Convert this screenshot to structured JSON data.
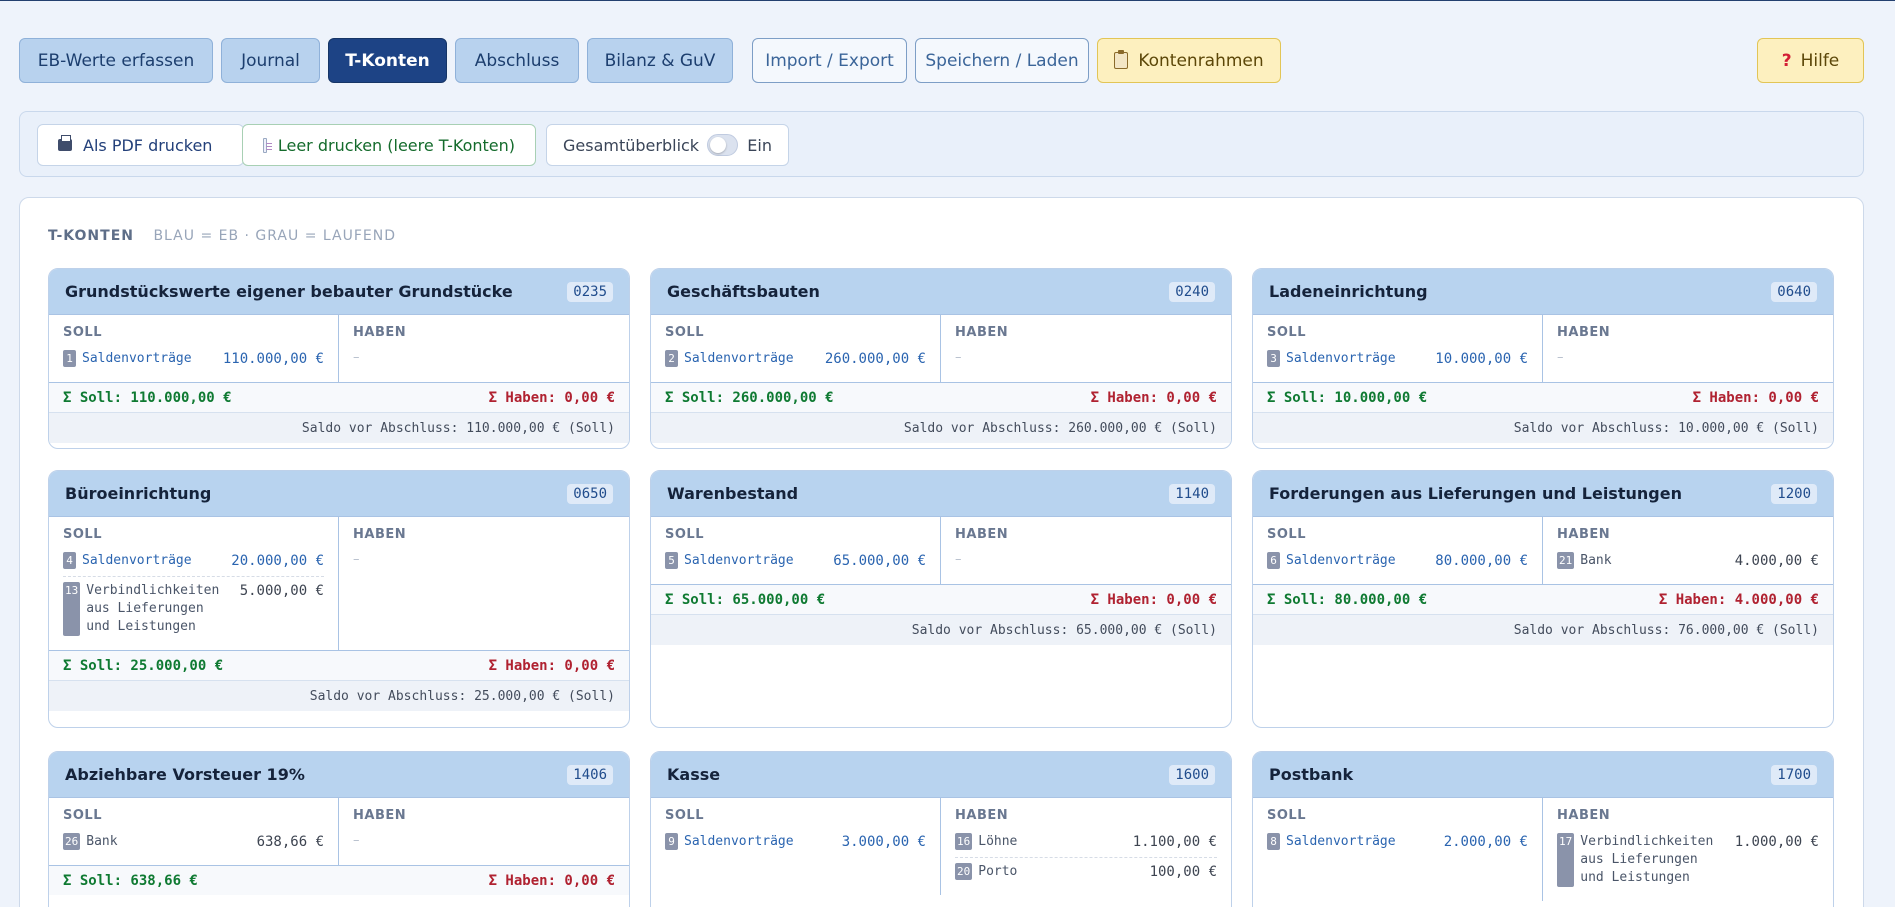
{
  "nav": {
    "eb": "EB-Werte erfassen",
    "journal": "Journal",
    "tkonten": "T-Konten",
    "abschluss": "Abschluss",
    "bilanz": "Bilanz & GuV",
    "import": "Import / Export",
    "speichern": "Speichern / Laden",
    "kontenrahmen": "Kontenrahmen",
    "hilfe": "Hilfe"
  },
  "toolbar": {
    "pdf": "Als PDF drucken",
    "leer": "Leer drucken (leere T-Konten)",
    "overview_label": "Gesamtüberblick",
    "overview_state": "Ein"
  },
  "section": {
    "title": "T-KONTEN",
    "subtitle": "BLAU = EB · GRAU = LAUFEND"
  },
  "labels": {
    "soll": "SOLL",
    "haben": "HABEN",
    "dash": "–"
  },
  "accounts": [
    {
      "title": "Grundstückswerte eigener bebauter Grundstücke",
      "number": "0235",
      "soll": [
        {
          "id": "1",
          "name": "Saldenvorträge",
          "amount": "110.000,00 €"
        }
      ],
      "haben": [],
      "sum_soll": "Σ Soll: 110.000,00 €",
      "sum_haben": "Σ Haben: 0,00 €",
      "saldo": "Saldo vor Abschluss: 110.000,00 € (Soll)"
    },
    {
      "title": "Geschäftsbauten",
      "number": "0240",
      "soll": [
        {
          "id": "2",
          "name": "Saldenvorträge",
          "amount": "260.000,00 €"
        }
      ],
      "haben": [],
      "sum_soll": "Σ Soll: 260.000,00 €",
      "sum_haben": "Σ Haben: 0,00 €",
      "saldo": "Saldo vor Abschluss: 260.000,00 € (Soll)"
    },
    {
      "title": "Ladeneinrichtung",
      "number": "0640",
      "soll": [
        {
          "id": "3",
          "name": "Saldenvorträge",
          "amount": "10.000,00 €"
        }
      ],
      "haben": [],
      "sum_soll": "Σ Soll: 10.000,00 €",
      "sum_haben": "Σ Haben: 0,00 €",
      "saldo": "Saldo vor Abschluss: 10.000,00 € (Soll)"
    },
    {
      "title": "Büroeinrichtung",
      "number": "0650",
      "soll": [
        {
          "id": "4",
          "name": "Saldenvorträge",
          "amount": "20.000,00 €"
        },
        {
          "id": "13",
          "name": "Verbindlichkeiten aus Lieferungen und Leistungen",
          "amount": "5.000,00 €"
        }
      ],
      "haben": [],
      "sum_soll": "Σ Soll: 25.000,00 €",
      "sum_haben": "Σ Haben: 0,00 €",
      "saldo": "Saldo vor Abschluss: 25.000,00 € (Soll)"
    },
    {
      "title": "Warenbestand",
      "number": "1140",
      "soll": [
        {
          "id": "5",
          "name": "Saldenvorträge",
          "amount": "65.000,00 €"
        }
      ],
      "haben": [],
      "sum_soll": "Σ Soll: 65.000,00 €",
      "sum_haben": "Σ Haben: 0,00 €",
      "saldo": "Saldo vor Abschluss: 65.000,00 € (Soll)"
    },
    {
      "title": "Forderungen aus Lieferungen und Leistungen",
      "number": "1200",
      "soll": [
        {
          "id": "6",
          "name": "Saldenvorträge",
          "amount": "80.000,00 €"
        }
      ],
      "haben": [
        {
          "id": "21",
          "name": "Bank",
          "amount": "4.000,00 €"
        }
      ],
      "sum_soll": "Σ Soll: 80.000,00 €",
      "sum_haben": "Σ Haben: 4.000,00 €",
      "saldo": "Saldo vor Abschluss: 76.000,00 € (Soll)"
    },
    {
      "title": "Abziehbare Vorsteuer 19%",
      "number": "1406",
      "soll": [
        {
          "id": "26",
          "name": "Bank",
          "amount": "638,66 €"
        }
      ],
      "haben": [],
      "sum_soll": "Σ Soll: 638,66 €",
      "sum_haben": "Σ Haben: 0,00 €",
      "saldo": ""
    },
    {
      "title": "Kasse",
      "number": "1600",
      "soll": [
        {
          "id": "9",
          "name": "Saldenvorträge",
          "amount": "3.000,00 €"
        }
      ],
      "haben": [
        {
          "id": "16",
          "name": "Löhne",
          "amount": "1.100,00 €"
        },
        {
          "id": "20",
          "name": "Porto",
          "amount": "100,00 €"
        }
      ],
      "sum_soll": "",
      "sum_haben": "",
      "saldo": ""
    },
    {
      "title": "Postbank",
      "number": "1700",
      "soll": [
        {
          "id": "8",
          "name": "Saldenvorträge",
          "amount": "2.000,00 €"
        }
      ],
      "haben": [
        {
          "id": "17",
          "name": "Verbindlichkeiten aus Lieferungen und Leistungen",
          "amount": "1.000,00 €"
        }
      ],
      "sum_soll": "",
      "sum_haben": "",
      "saldo": ""
    }
  ]
}
